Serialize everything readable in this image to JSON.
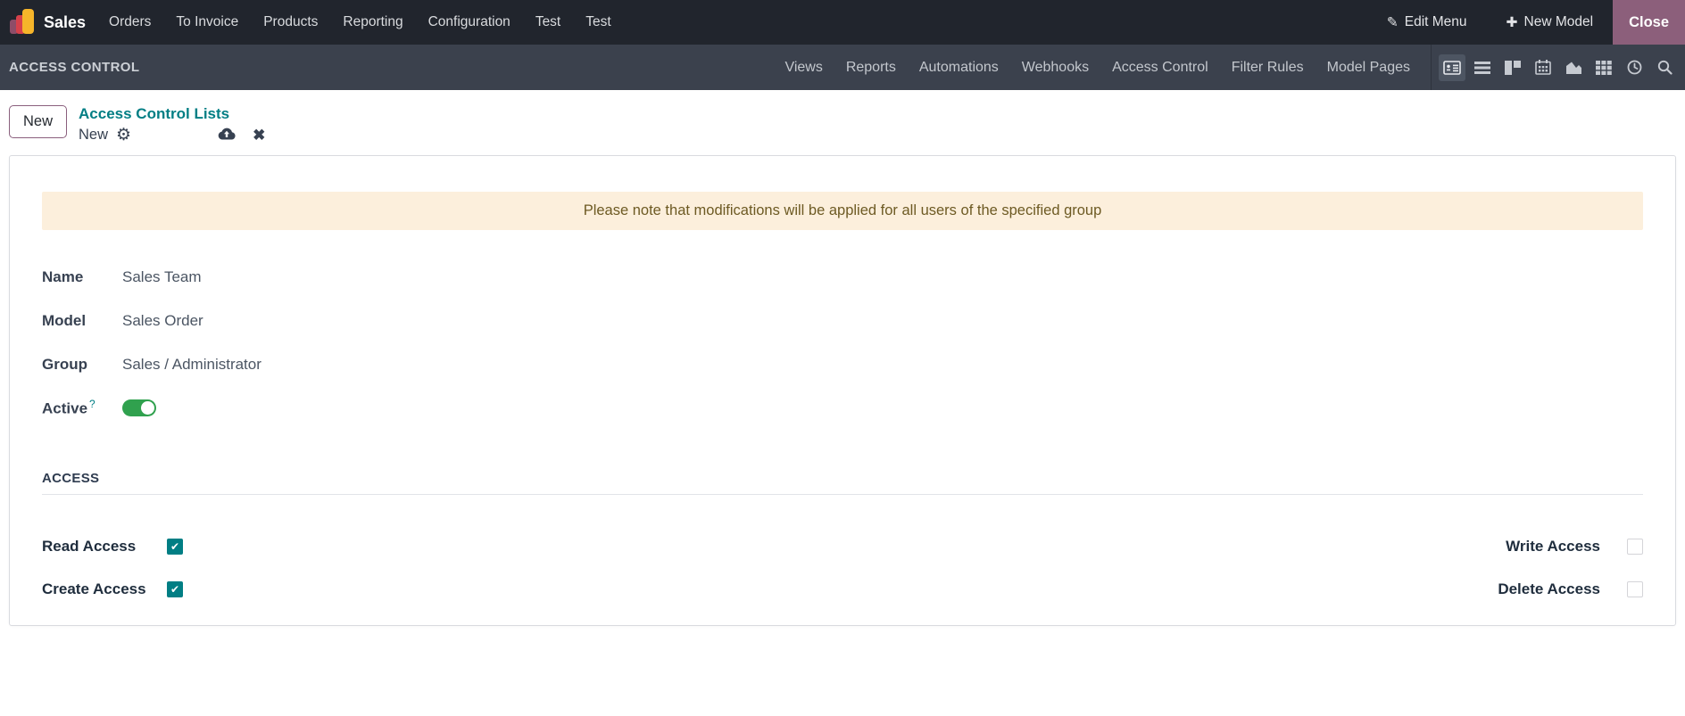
{
  "navbar": {
    "app_name": "Sales",
    "menu_items": [
      "Orders",
      "To Invoice",
      "Products",
      "Reporting",
      "Configuration",
      "Test",
      "Test"
    ],
    "edit_menu_label": "Edit Menu",
    "new_model_label": "New Model",
    "close_label": "Close"
  },
  "control_bar": {
    "title": "ACCESS CONTROL",
    "tabs": [
      "Views",
      "Reports",
      "Automations",
      "Webhooks",
      "Access Control",
      "Filter Rules",
      "Model Pages"
    ],
    "view_switcher": [
      "form-view",
      "list-view",
      "kanban-view",
      "calendar-view",
      "graph-view",
      "pivot-view",
      "activity-view",
      "search"
    ]
  },
  "breadcrumb": {
    "new_button_label": "New",
    "parent_link": "Access Control Lists",
    "current": "New"
  },
  "form": {
    "warning_text": "Please note that modifications will be applied for all users of the specified group",
    "fields": [
      {
        "label": "Name",
        "value": "Sales Team"
      },
      {
        "label": "Model",
        "value": "Sales Order"
      },
      {
        "label": "Group",
        "value": "Sales / Administrator"
      }
    ],
    "active": {
      "label": "Active",
      "help": "?",
      "on": true
    },
    "access_section_title": "ACCESS",
    "access_rights": {
      "read": {
        "label": "Read Access",
        "checked": true
      },
      "write": {
        "label": "Write Access",
        "checked": false
      },
      "create": {
        "label": "Create Access",
        "checked": true
      },
      "delete": {
        "label": "Delete Access",
        "checked": false
      }
    }
  },
  "colors": {
    "navbar_bg": "#21252d",
    "controlbar_bg": "#3b414d",
    "close_button_bg": "#8c5f7b",
    "accent_teal": "#017e84",
    "toggle_green": "#30a14e",
    "warning_bg": "#fcefdc",
    "warning_text": "#6d5a23"
  }
}
